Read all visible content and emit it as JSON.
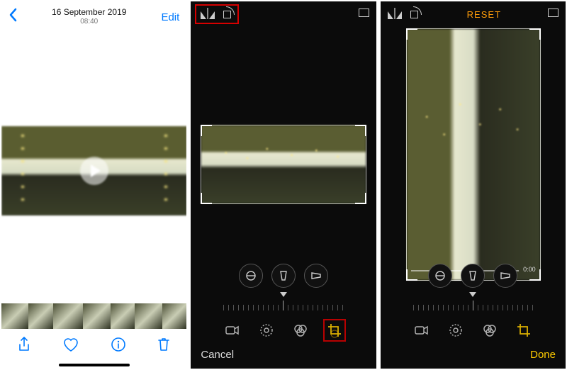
{
  "panel1": {
    "date": "16 September 2019",
    "time": "08:40",
    "edit": "Edit",
    "back_icon": "chevron-left",
    "toolbar": {
      "share": "share-icon",
      "favorite": "heart-icon",
      "info": "info-icon",
      "delete": "trash-icon"
    }
  },
  "panel2": {
    "top_icons": [
      "flip-icon",
      "rotate-icon"
    ],
    "aspect_icon": "aspect-ratio-icon",
    "cancel": "Cancel",
    "adjust_tabs": [
      "straighten",
      "vertical-perspective",
      "horizontal-perspective"
    ],
    "tool_tabs": [
      "video",
      "adjust",
      "filters",
      "crop"
    ],
    "active_tool": "crop"
  },
  "panel3": {
    "top_icons": [
      "flip-icon",
      "rotate-icon"
    ],
    "reset_label": "RESET",
    "aspect_icon": "aspect-ratio-icon",
    "timecode": "0:00",
    "done": "Done",
    "adjust_tabs": [
      "straighten",
      "vertical-perspective",
      "horizontal-perspective"
    ],
    "tool_tabs": [
      "video",
      "adjust",
      "filters",
      "crop"
    ],
    "active_tool": "crop"
  }
}
